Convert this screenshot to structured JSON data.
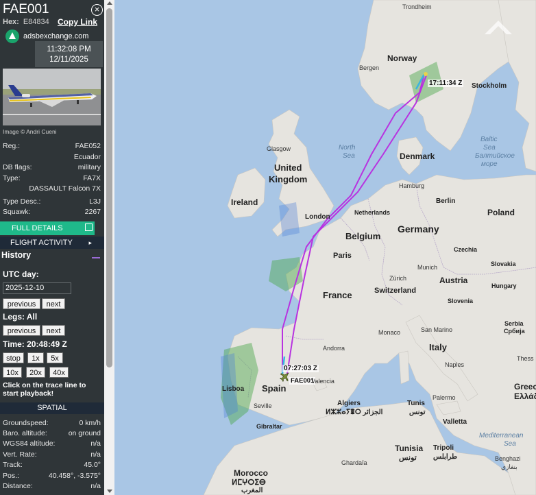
{
  "aircraft": {
    "callsign": "FAE001",
    "hex_label": "Hex:",
    "hex": "E84834",
    "copy_link": "Copy Link",
    "site": "adsbexchange.com",
    "clock_time": "11:32:08 PM",
    "clock_date": "12/11/2025",
    "image_credit": "Image © Andri Cueni"
  },
  "details": [
    {
      "label": "Reg.:",
      "value": "FAE052"
    },
    {
      "label": "",
      "value": "Ecuador"
    },
    {
      "label": "DB flags:",
      "value": "military"
    },
    {
      "label": "Type:",
      "value": "FA7X"
    },
    {
      "label": "",
      "value": "DASSAULT Falcon 7X"
    },
    {
      "label": "Type Desc.:",
      "value": "L3J"
    },
    {
      "label": "Squawk:",
      "value": "2267"
    }
  ],
  "buttons": {
    "full_details": "FULL DETAILS",
    "flight_activity": "FLIGHT ACTIVITY",
    "arrow": "▸"
  },
  "history": {
    "title": "History",
    "utc_day_label": "UTC day:",
    "date_value": "2025-12-10",
    "previous": "previous",
    "next": "next",
    "legs_label": "Legs: All",
    "time_label": "Time: 20:48:49 Z",
    "speed_buttons": [
      "stop",
      "1x",
      "5x",
      "10x",
      "20x",
      "40x"
    ],
    "hint": "Click on the trace line to start playback!"
  },
  "spatial": {
    "title": "SPATIAL",
    "rows": [
      {
        "label": "Groundspeed:",
        "value": "0 km/h"
      },
      {
        "label": "Baro. altitude:",
        "value": "on ground"
      },
      {
        "label": "WGS84 altitude:",
        "value": "n/a"
      },
      {
        "label": "Vert. Rate:",
        "value": "n/a"
      },
      {
        "label": "Track:",
        "value": "45.0°"
      },
      {
        "label": "Pos.:",
        "value": "40.458°, -3.575°"
      },
      {
        "label": "Distance:",
        "value": "n/a"
      }
    ]
  },
  "map": {
    "trace_start_label": "07:27:03 Z",
    "trace_end_label": "17:11:34 Z",
    "aircraft_label": "FAE001",
    "trace_color": "#b833e0",
    "sea_color": "#a9c6e5",
    "land_color": "#e6e4df",
    "places": [
      {
        "name": "Trondheim",
        "cls": "city"
      },
      {
        "name": "Norway",
        "cls": "country"
      },
      {
        "name": "Bergen",
        "cls": "city"
      },
      {
        "name": "Stockholm",
        "cls": "city-b"
      },
      {
        "name": "North",
        "cls": "sea"
      },
      {
        "name": "Sea",
        "cls": "sea"
      },
      {
        "name": "Baltic",
        "cls": "sea"
      },
      {
        "name": "Sea",
        "cls": "sea"
      },
      {
        "name": "Балтийское",
        "cls": "sea"
      },
      {
        "name": "море",
        "cls": "sea"
      },
      {
        "name": "Glasgow",
        "cls": "city"
      },
      {
        "name": "United",
        "cls": "country"
      },
      {
        "name": "Kingdom",
        "cls": "country"
      },
      {
        "name": "Denmark",
        "cls": "country-s"
      },
      {
        "name": "Hamburg",
        "cls": "city"
      },
      {
        "name": "Ireland",
        "cls": "country-s"
      },
      {
        "name": "Berlin",
        "cls": "city-b"
      },
      {
        "name": "Poland",
        "cls": "country-s"
      },
      {
        "name": "Netherlands",
        "cls": "city-b"
      },
      {
        "name": "London",
        "cls": "city-b"
      },
      {
        "name": "Germany",
        "cls": "country"
      },
      {
        "name": "Belgium",
        "cls": "country"
      },
      {
        "name": "Czechia",
        "cls": "city-b"
      },
      {
        "name": "Paris",
        "cls": "city-b"
      },
      {
        "name": "Slovakia",
        "cls": "city-b"
      },
      {
        "name": "Munich",
        "cls": "city"
      },
      {
        "name": "Austria",
        "cls": "country-s"
      },
      {
        "name": "Zürich",
        "cls": "city"
      },
      {
        "name": "France",
        "cls": "country"
      },
      {
        "name": "Switzerland",
        "cls": "country-s"
      },
      {
        "name": "Hungary",
        "cls": "city-b"
      },
      {
        "name": "Slovenia",
        "cls": "city-b"
      },
      {
        "name": "Serbia",
        "cls": "city-b"
      },
      {
        "name": "Србија",
        "cls": "city-b"
      },
      {
        "name": "Andorra",
        "cls": "city"
      },
      {
        "name": "Monaco",
        "cls": "city"
      },
      {
        "name": "San Marino",
        "cls": "city"
      },
      {
        "name": "Italy",
        "cls": "country"
      },
      {
        "name": "Thess",
        "cls": "city"
      },
      {
        "name": "Naples",
        "cls": "city"
      },
      {
        "name": "Lisboa",
        "cls": "city-b"
      },
      {
        "name": "Spain",
        "cls": "country"
      },
      {
        "name": "Valencia",
        "cls": "city"
      },
      {
        "name": "Greec",
        "cls": "country"
      },
      {
        "name": "Ελλάδ",
        "cls": "country"
      },
      {
        "name": "Seville",
        "cls": "city"
      },
      {
        "name": "Algiers",
        "cls": "city-b"
      },
      {
        "name": "ⵍⵣⵣⴰⵢⴻⵔ الجزائر",
        "cls": "city-b"
      },
      {
        "name": "Tunis",
        "cls": "city-b"
      },
      {
        "name": "تونس",
        "cls": "city-b"
      },
      {
        "name": "Palermo",
        "cls": "city"
      },
      {
        "name": "Gibraltar",
        "cls": "city-b"
      },
      {
        "name": "Valletta",
        "cls": "city-b"
      },
      {
        "name": "Mediterranean",
        "cls": "sea"
      },
      {
        "name": "Sea",
        "cls": "sea"
      },
      {
        "name": "Tunisia",
        "cls": "country-s"
      },
      {
        "name": "تونس",
        "cls": "country-s"
      },
      {
        "name": "Tripoli",
        "cls": "city-b"
      },
      {
        "name": "طرابلس",
        "cls": "city-b"
      },
      {
        "name": "Benghazi",
        "cls": "city"
      },
      {
        "name": "بنغازي",
        "cls": "city"
      },
      {
        "name": "Ghardaïa",
        "cls": "city"
      },
      {
        "name": "Morocco",
        "cls": "country-s"
      },
      {
        "name": "ⵍⵎⵖⵔⵉⴱ",
        "cls": "country-s"
      },
      {
        "name": "المغرب",
        "cls": "country-s"
      }
    ]
  }
}
